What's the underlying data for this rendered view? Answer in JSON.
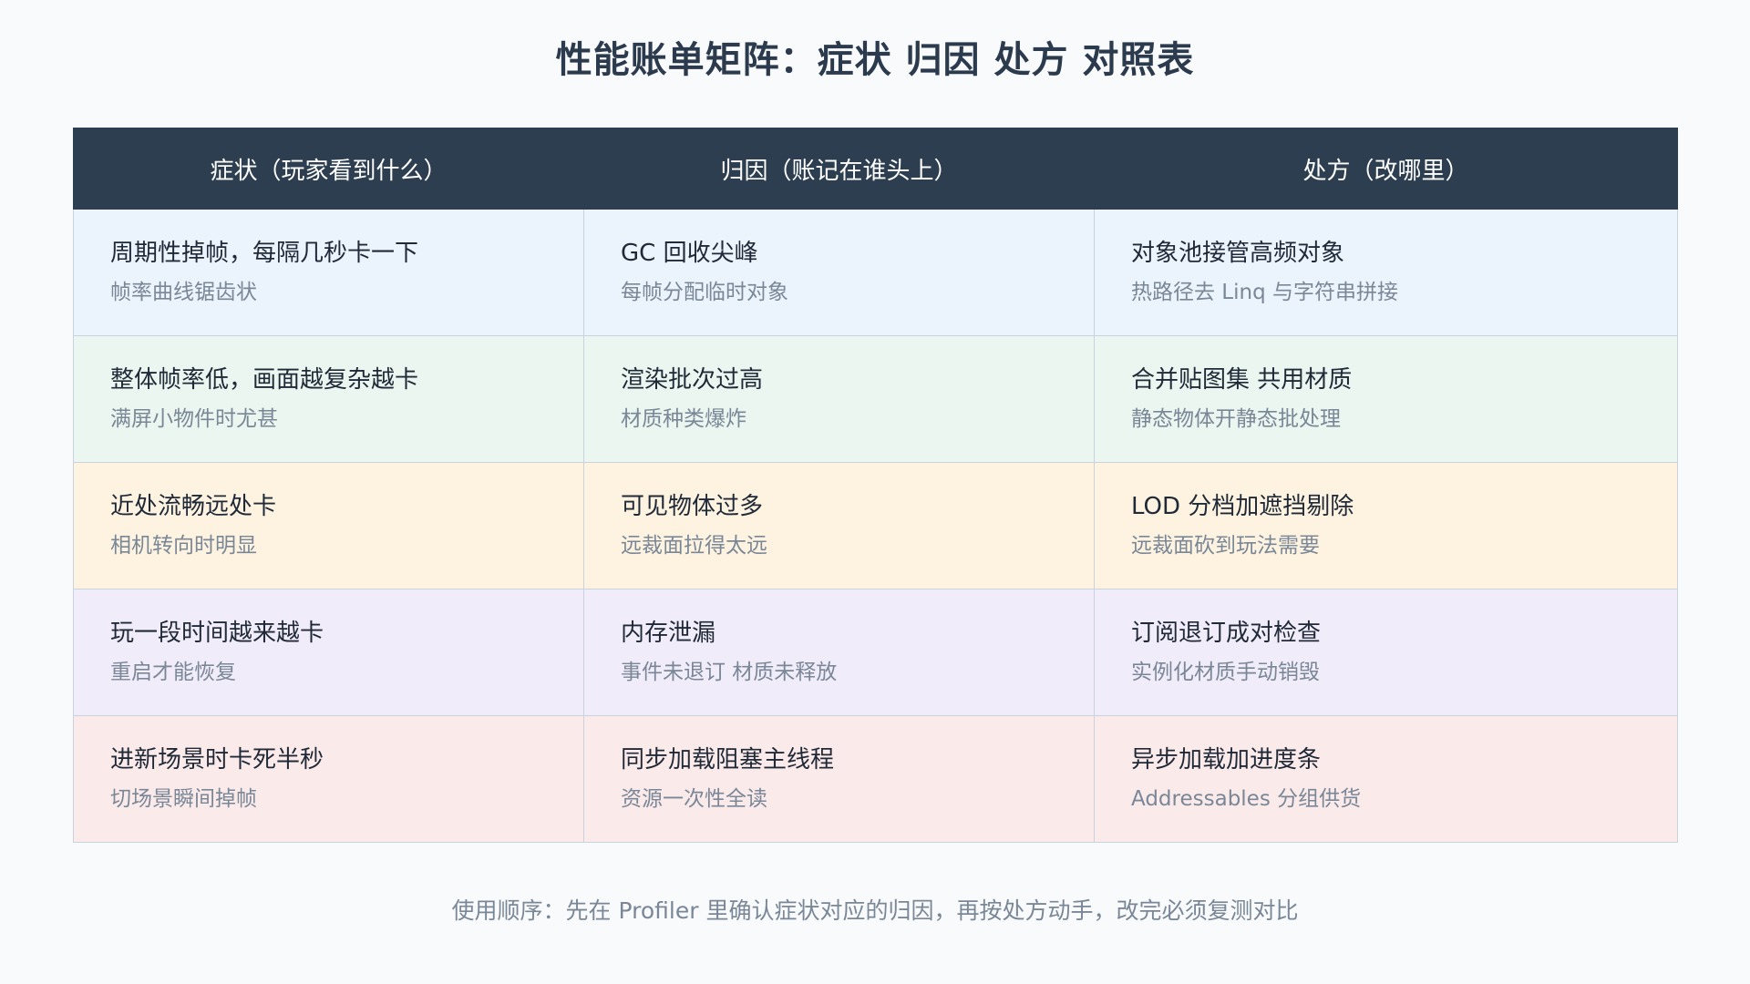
{
  "title": "性能账单矩阵：症状 归因 处方 对照表",
  "headers": [
    "症状（玩家看到什么）",
    "归因（账记在谁头上）",
    "处方（改哪里）"
  ],
  "rows": [
    {
      "symptom": {
        "main": "周期性掉帧，每隔几秒卡一下",
        "sub": "帧率曲线锯齿状"
      },
      "cause": {
        "main": "GC 回收尖峰",
        "sub": "每帧分配临时对象"
      },
      "fix": {
        "main": "对象池接管高频对象",
        "sub": "热路径去 Linq 与字符串拼接"
      }
    },
    {
      "symptom": {
        "main": "整体帧率低，画面越复杂越卡",
        "sub": "满屏小物件时尤甚"
      },
      "cause": {
        "main": "渲染批次过高",
        "sub": "材质种类爆炸"
      },
      "fix": {
        "main": "合并贴图集 共用材质",
        "sub": "静态物体开静态批处理"
      }
    },
    {
      "symptom": {
        "main": "近处流畅远处卡",
        "sub": "相机转向时明显"
      },
      "cause": {
        "main": "可见物体过多",
        "sub": "远裁面拉得太远"
      },
      "fix": {
        "main": "LOD 分档加遮挡剔除",
        "sub": "远裁面砍到玩法需要"
      }
    },
    {
      "symptom": {
        "main": "玩一段时间越来越卡",
        "sub": "重启才能恢复"
      },
      "cause": {
        "main": "内存泄漏",
        "sub": "事件未退订 材质未释放"
      },
      "fix": {
        "main": "订阅退订成对检查",
        "sub": "实例化材质手动销毁"
      }
    },
    {
      "symptom": {
        "main": "进新场景时卡死半秒",
        "sub": "切场景瞬间掉帧"
      },
      "cause": {
        "main": "同步加载阻塞主线程",
        "sub": "资源一次性全读"
      },
      "fix": {
        "main": "异步加载加进度条",
        "sub": "Addressables 分组供货"
      }
    }
  ],
  "footnote": "使用顺序：先在 Profiler 里确认症状对应的归因，再按处方动手，改完必须复测对比",
  "colors": {
    "header_bg": "#2c3e50",
    "row_backgrounds": [
      "#ebf3fc",
      "#eaf6ef",
      "#fdf3e0",
      "#f1ecf9",
      "#fbeaea"
    ]
  }
}
